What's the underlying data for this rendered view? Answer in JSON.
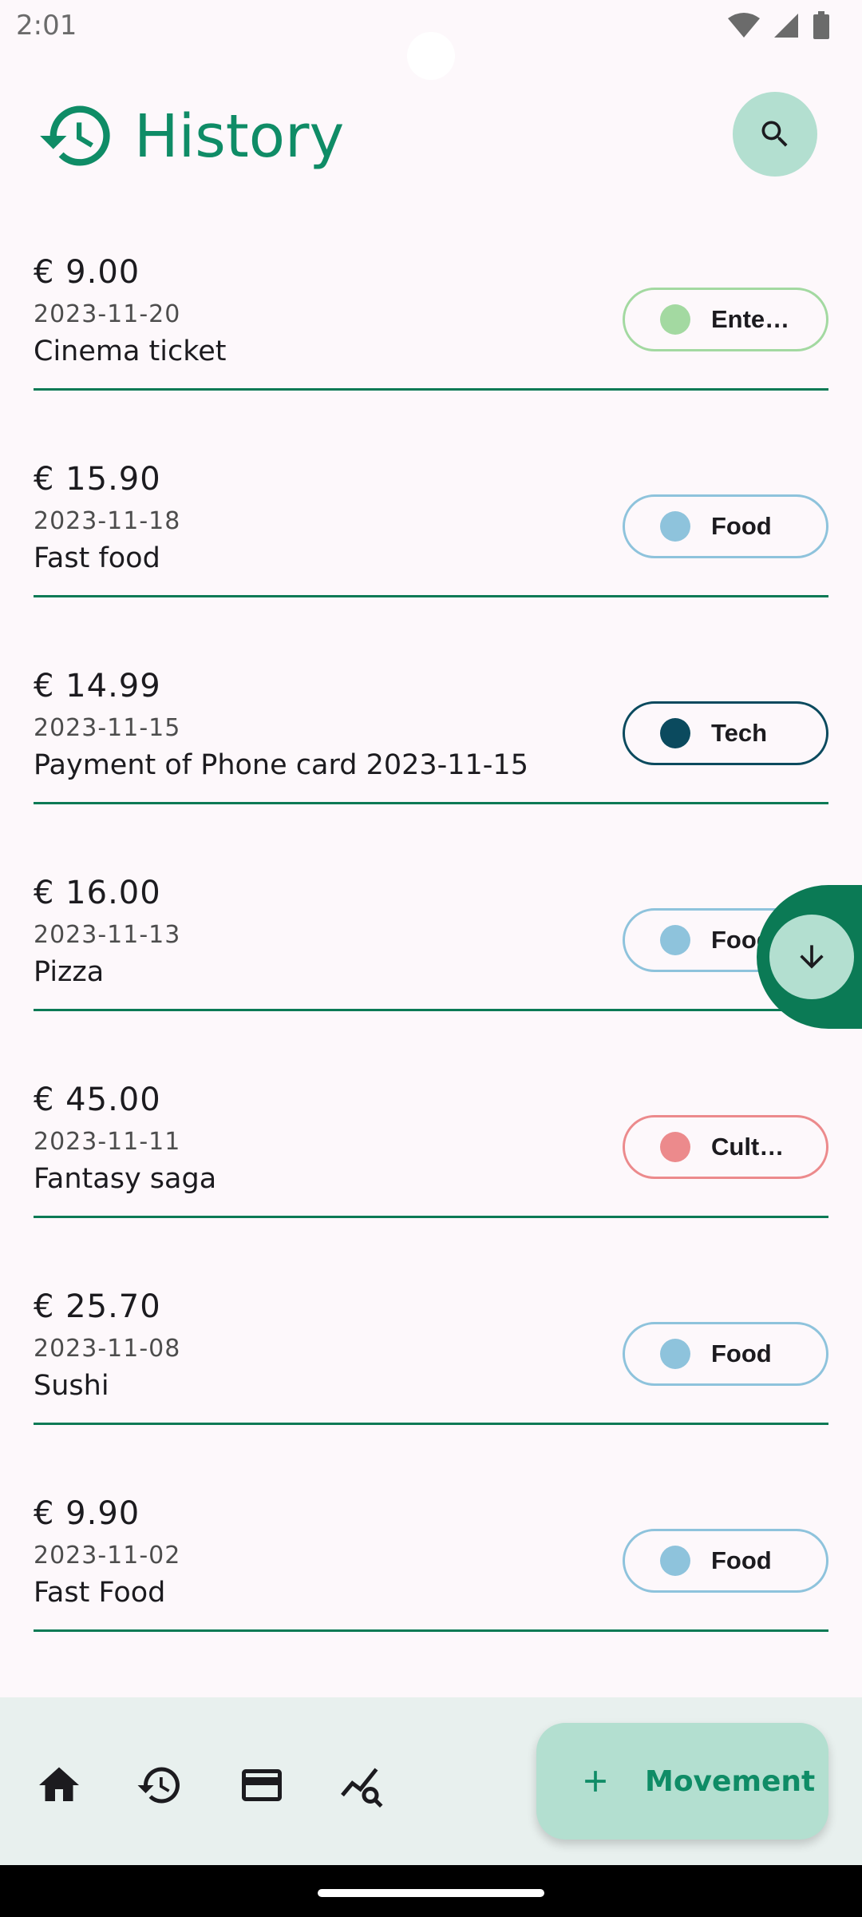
{
  "status": {
    "time": "2:01"
  },
  "header": {
    "title": "History"
  },
  "transactions": [
    {
      "amount": "€ 9.00",
      "date": "2023-11-20",
      "description": "Cinema ticket",
      "category": "Ente…",
      "color": "#a3d9a1",
      "border": "#a3d9a1"
    },
    {
      "amount": "€ 15.90",
      "date": "2023-11-18",
      "description": "Fast food",
      "category": "Food",
      "color": "#8ec3dc",
      "border": "#8ec3dc"
    },
    {
      "amount": "€ 14.99",
      "date": "2023-11-15",
      "description": "Payment of Phone card 2023-11-15",
      "category": "Tech",
      "color": "#0b4a5e",
      "border": "#0b4a5e"
    },
    {
      "amount": "€ 16.00",
      "date": "2023-11-13",
      "description": "Pizza",
      "category": "Food",
      "color": "#8ec3dc",
      "border": "#8ec3dc"
    },
    {
      "amount": "€ 45.00",
      "date": "2023-11-11",
      "description": "Fantasy saga",
      "category": "Cult…",
      "color": "#ec8a8c",
      "border": "#ec8a8c"
    },
    {
      "amount": "€ 25.70",
      "date": "2023-11-08",
      "description": "Sushi",
      "category": "Food",
      "color": "#8ec3dc",
      "border": "#8ec3dc"
    },
    {
      "amount": "€ 9.90",
      "date": "2023-11-02",
      "description": "Fast Food",
      "category": "Food",
      "color": "#8ec3dc",
      "border": "#8ec3dc"
    }
  ],
  "bottom_nav": {
    "items": [
      "home-icon",
      "history-icon",
      "credit-card-icon",
      "analytics-search-icon"
    ],
    "fab_label": "Movement"
  },
  "colors": {
    "accent": "#0f8c66",
    "divider": "#0b7a55",
    "fab": "#b3dfd0"
  }
}
